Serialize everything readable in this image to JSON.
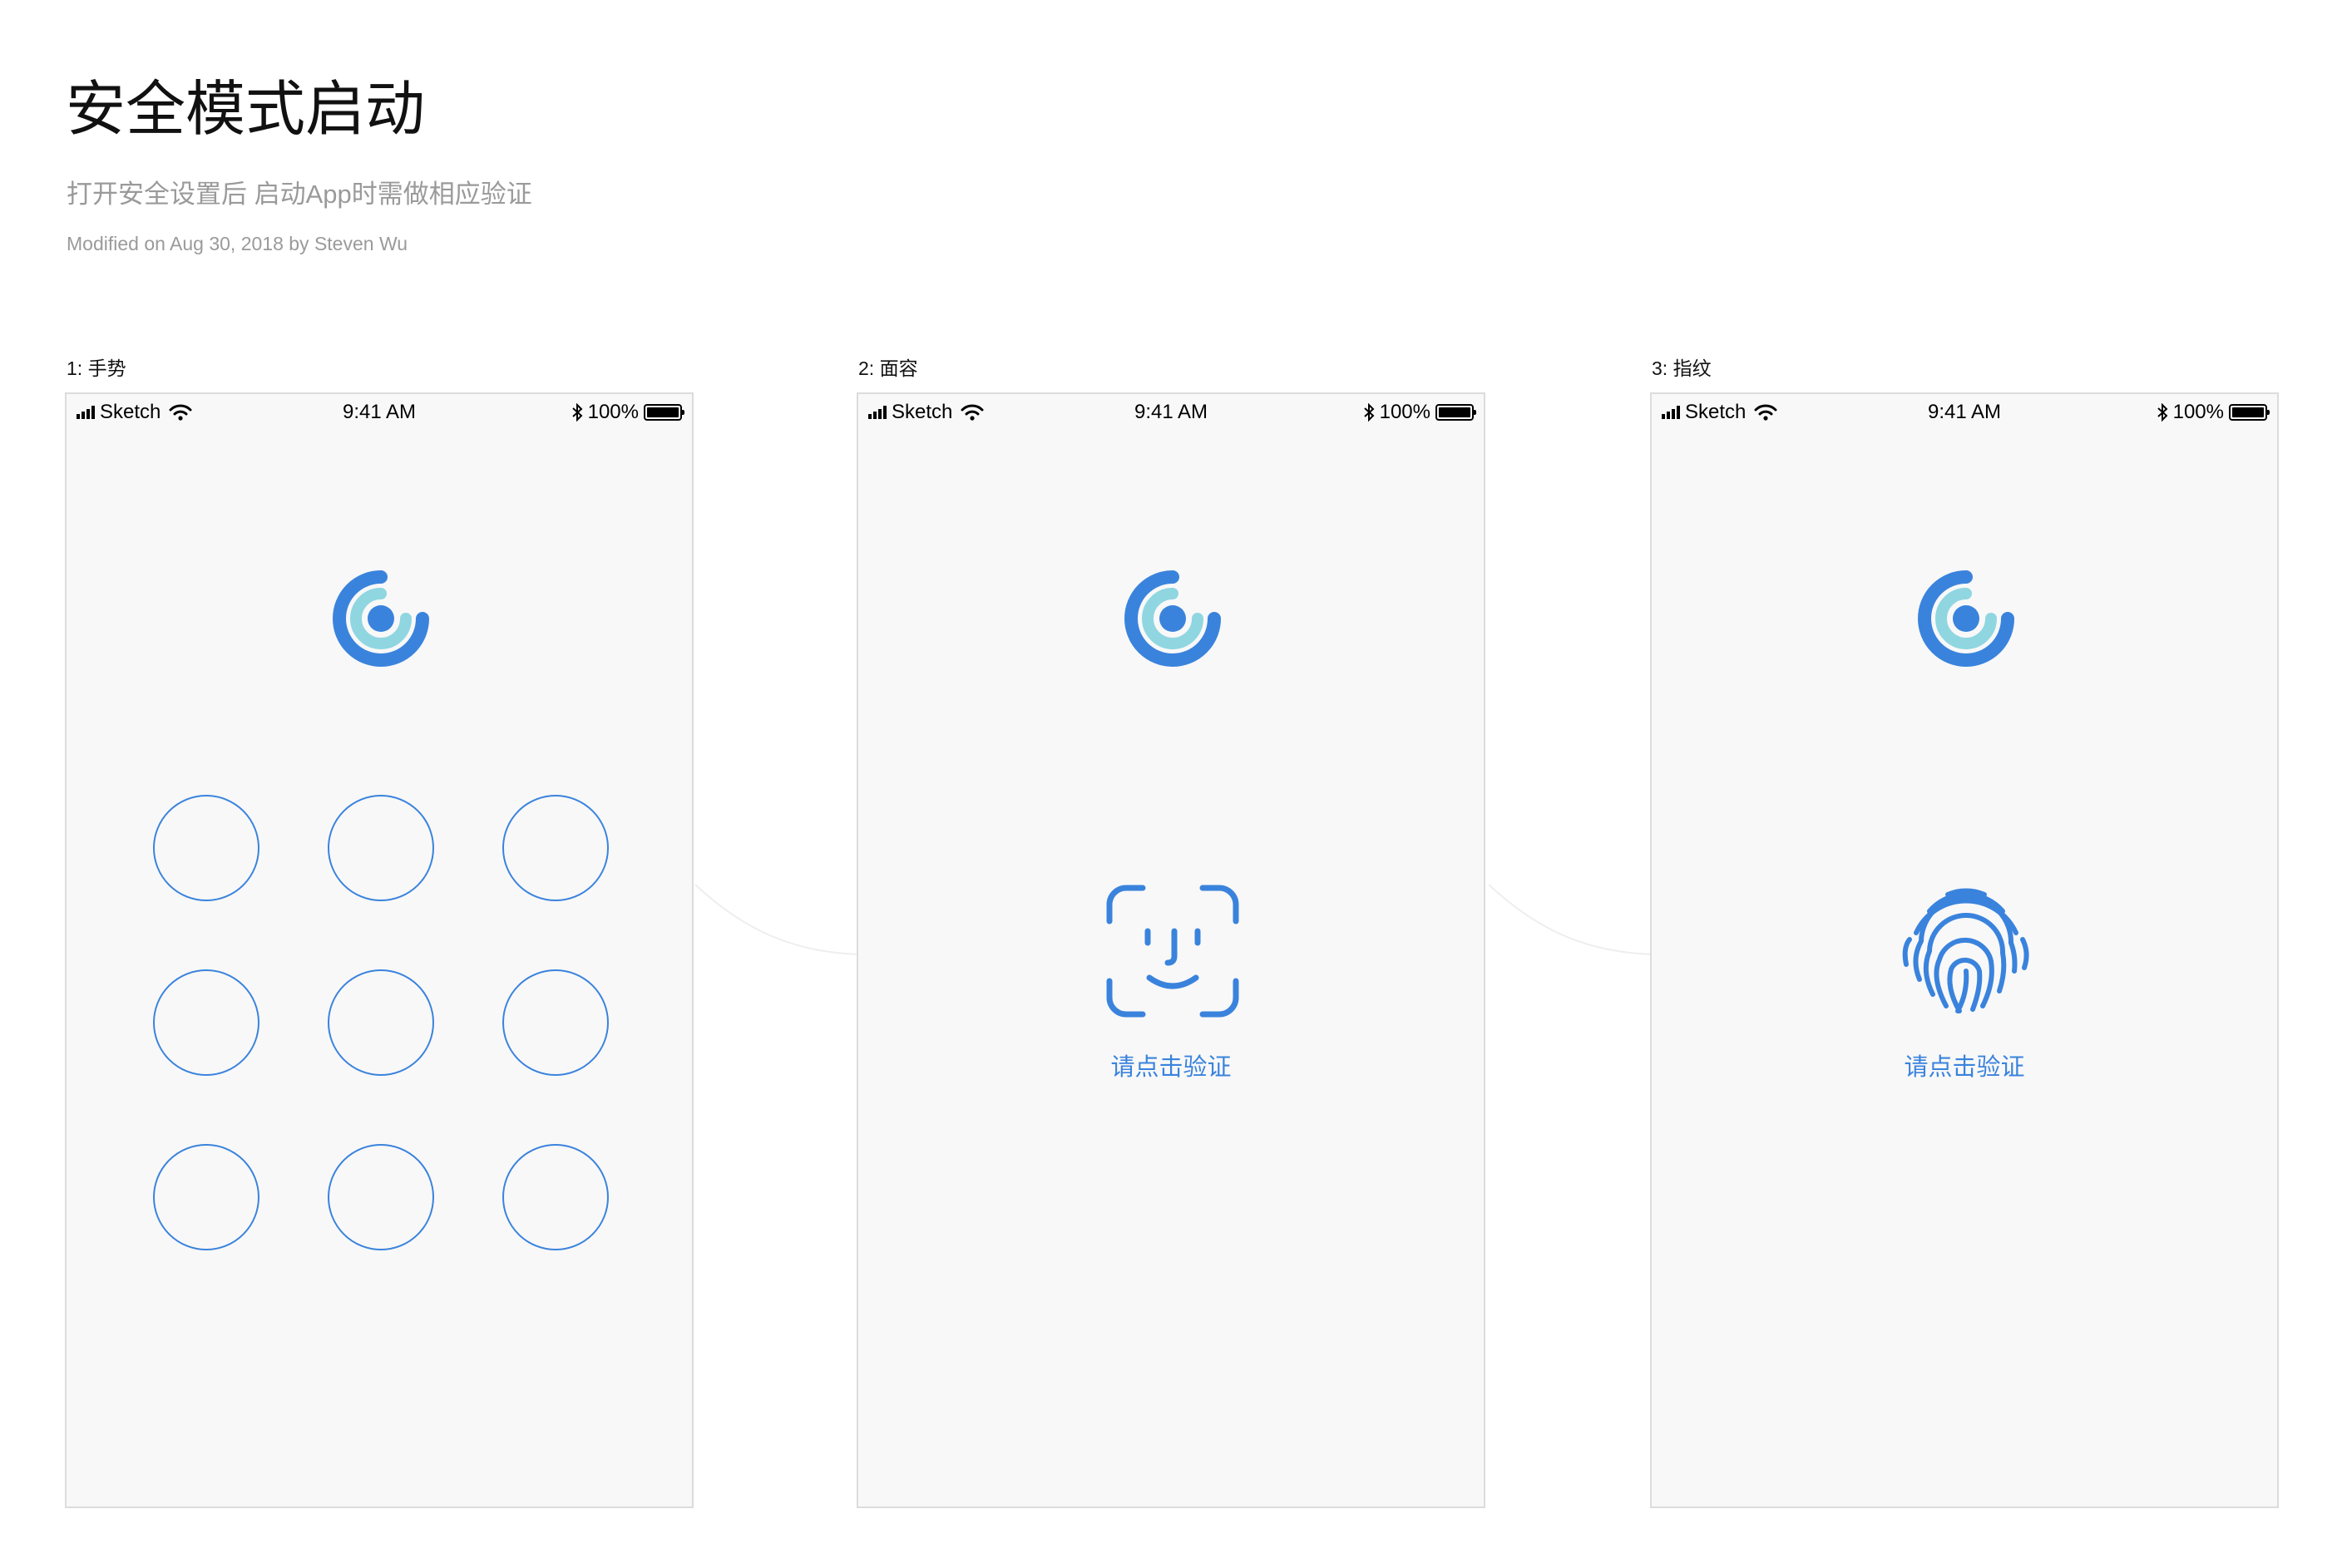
{
  "document": {
    "title": "安全模式启动",
    "subtitle": "打开安全设置后 启动App时需做相应验证",
    "meta": "Modified on Aug 30, 2018 by Steven Wu"
  },
  "status_bar": {
    "carrier": "Sketch",
    "time": "9:41 AM",
    "battery": "100%"
  },
  "artboards": [
    {
      "label": "1: 手势",
      "type": "gesture",
      "pattern_dots": 9
    },
    {
      "label": "2: 面容",
      "type": "face",
      "action_label": "请点击验证",
      "icon": "face-id-icon"
    },
    {
      "label": "3: 指纹",
      "type": "fingerprint",
      "action_label": "请点击验证",
      "icon": "fingerprint-icon"
    }
  ],
  "colors": {
    "accent": "#3a83dd",
    "logo_light": "#8fd6e1",
    "phone_bg": "#f8f8f8",
    "muted_text": "#9a9a9a"
  }
}
